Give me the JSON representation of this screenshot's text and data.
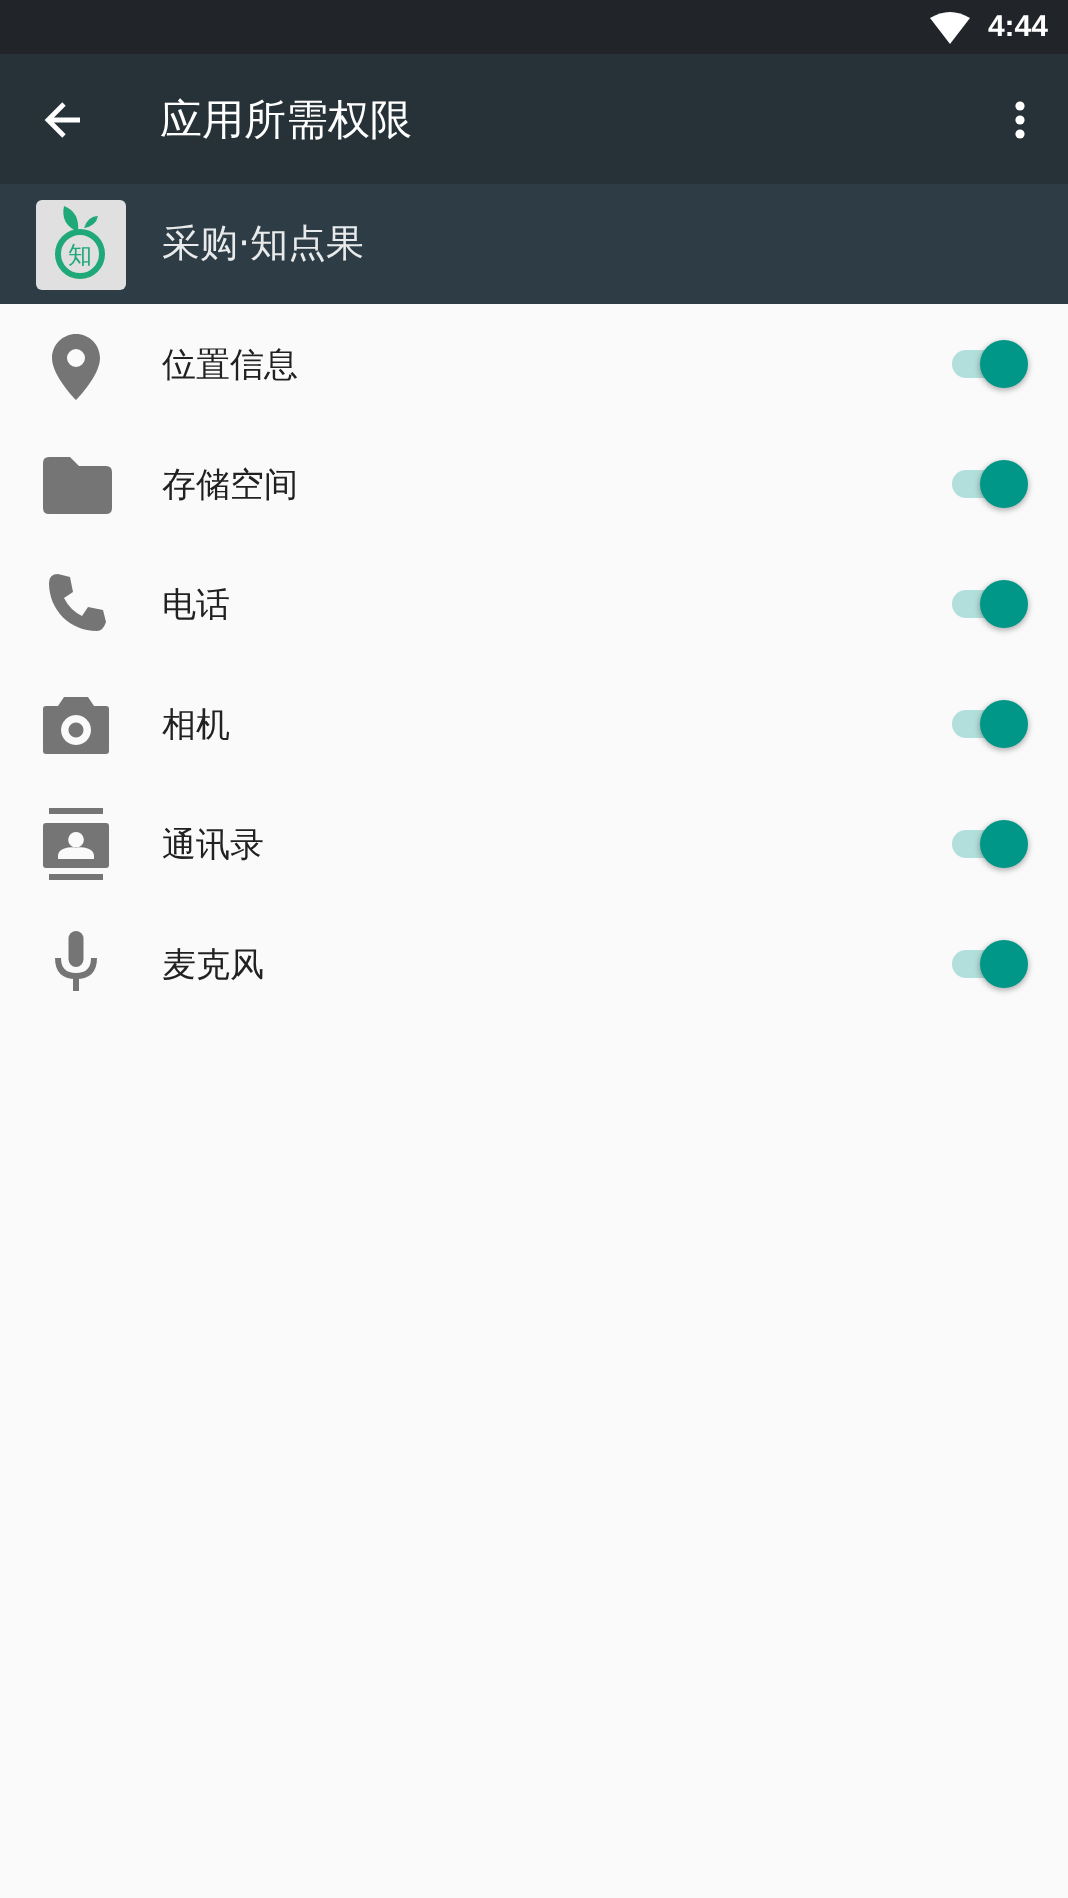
{
  "status_bar": {
    "time": "4:44"
  },
  "toolbar": {
    "title": "应用所需权限"
  },
  "app": {
    "icon_text": "知",
    "name": "采购·知点果"
  },
  "permissions": [
    {
      "kind": "location",
      "label": "位置信息",
      "on": true
    },
    {
      "kind": "folder",
      "label": "存储空间",
      "on": true
    },
    {
      "kind": "phone",
      "label": "电话",
      "on": true
    },
    {
      "kind": "camera",
      "label": "相机",
      "on": true
    },
    {
      "kind": "contacts",
      "label": "通讯录",
      "on": true
    },
    {
      "kind": "microphone",
      "label": "麦克风",
      "on": true
    }
  ]
}
